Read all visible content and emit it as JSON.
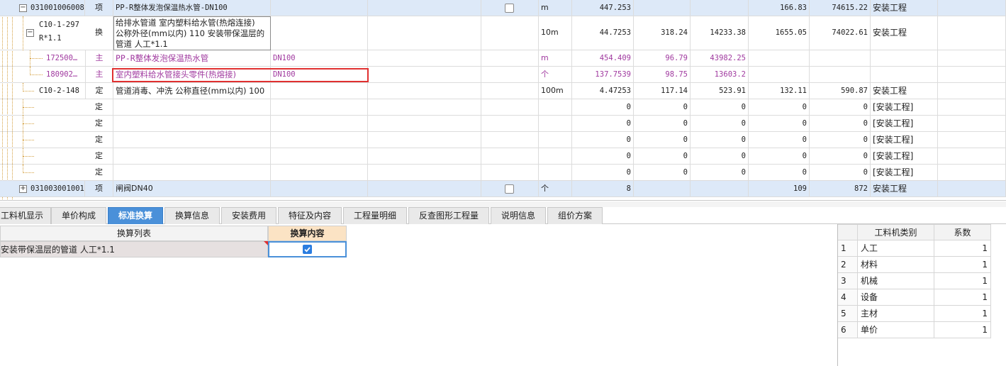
{
  "rows": [
    {
      "code": "031001006008",
      "type": "项",
      "name": "PP-R整体发泡保温热水管-DN100",
      "unit": "m",
      "qty": "447.253",
      "c1": "",
      "c2": "",
      "c3": "166.83",
      "c4": "74615.22",
      "category": "安装工程"
    },
    {
      "code_line1": "C10-1-297",
      "code_line2": "R*1.1",
      "type": "换",
      "name_lines": [
        "给排水管道 室内塑料给水管(热熔连接)",
        "公称外径(mm以内) 110  安装带保温层的",
        "管道 人工*1.1"
      ],
      "unit": "10m",
      "qty": "44.7253",
      "c1": "318.24",
      "c2": "14233.38",
      "c3": "1655.05",
      "c4": "74022.61",
      "category": "安装工程"
    },
    {
      "code": "172500…",
      "type": "主",
      "name": "PP-R整体发泡保温热水管",
      "spec": "DN100",
      "unit": "m",
      "qty": "454.409",
      "c1": "96.79",
      "c2": "43982.25"
    },
    {
      "code": "180902…",
      "type": "主",
      "name": "室内塑料给水管接头零件(热熔接)",
      "spec": "DN100",
      "unit": "个",
      "qty": "137.7539",
      "c1": "98.75",
      "c2": "13603.2"
    },
    {
      "code": "C10-2-148",
      "type": "定",
      "name": "管道消毒、冲洗 公称直径(mm以内) 100",
      "unit": "100m",
      "qty": "4.47253",
      "c1": "117.14",
      "c2": "523.91",
      "c3": "132.11",
      "c4": "590.87",
      "category": "安装工程"
    },
    {
      "type": "定",
      "qty": "0",
      "c1": "0",
      "c2": "0",
      "c3": "0",
      "c4": "0",
      "category": "[安装工程]"
    },
    {
      "type": "定",
      "qty": "0",
      "c1": "0",
      "c2": "0",
      "c3": "0",
      "c4": "0",
      "category": "[安装工程]"
    },
    {
      "type": "定",
      "qty": "0",
      "c1": "0",
      "c2": "0",
      "c3": "0",
      "c4": "0",
      "category": "[安装工程]"
    },
    {
      "type": "定",
      "qty": "0",
      "c1": "0",
      "c2": "0",
      "c3": "0",
      "c4": "0",
      "category": "[安装工程]"
    },
    {
      "type": "定",
      "qty": "0",
      "c1": "0",
      "c2": "0",
      "c3": "0",
      "c4": "0",
      "category": "[安装工程]"
    },
    {
      "code": "031003001001",
      "type": "项",
      "name": "闸阀DN40",
      "unit": "个",
      "qty": "8",
      "c1": "",
      "c2": "",
      "c3": "109",
      "c4": "872",
      "category": "安装工程"
    }
  ],
  "tabs": [
    "工料机显示",
    "单价构成",
    "标准换算",
    "换算信息",
    "安装费用",
    "特征及内容",
    "工程量明细",
    "反查图形工程量",
    "说明信息",
    "组价方案"
  ],
  "active_tab": "标准换算",
  "conversion": {
    "col_list": "换算列表",
    "col_content": "换算内容",
    "item": "安装带保温层的管道 人工*1.1",
    "checked": true
  },
  "coefficients": {
    "col_category": "工料机类别",
    "col_factor": "系数",
    "rows": [
      {
        "no": "1",
        "category": "人工",
        "factor": "1"
      },
      {
        "no": "2",
        "category": "材料",
        "factor": "1"
      },
      {
        "no": "3",
        "category": "机械",
        "factor": "1"
      },
      {
        "no": "4",
        "category": "设备",
        "factor": "1"
      },
      {
        "no": "5",
        "category": "主材",
        "factor": "1"
      },
      {
        "no": "6",
        "category": "单价",
        "factor": "1"
      }
    ]
  },
  "colors": {
    "accent": "#4a90d9",
    "highlight_row": "#dde9f8",
    "red_box": "#e03030",
    "purple_text": "#a0399f"
  }
}
